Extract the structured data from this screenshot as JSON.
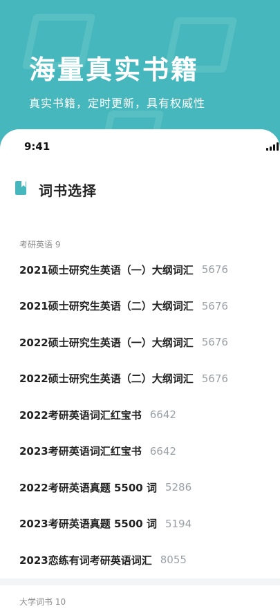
{
  "hero": {
    "title": "海量真实书籍",
    "subtitle": "真实书籍，定时更新，具有权威性"
  },
  "status_bar": {
    "time": "9:41",
    "icons": [
      "signal-icon",
      "wifi-icon",
      "battery-icon"
    ]
  },
  "section": {
    "icon": "book-icon",
    "title": "词书选择"
  },
  "groups": [
    {
      "label": "考研英语 9",
      "items": [
        {
          "title": "2021硕士研究生英语（一）大纲词汇",
          "count": "5676"
        },
        {
          "title": "2021硕士研究生英语（二）大纲词汇",
          "count": "5676"
        },
        {
          "title": "2022硕士研究生英语（一）大纲词汇",
          "count": "5676"
        },
        {
          "title": "2022硕士研究生英语（二）大纲词汇",
          "count": "5676"
        },
        {
          "title": "2022考研英语词汇红宝书",
          "count": "6642"
        },
        {
          "title": "2023考研英语词汇红宝书",
          "count": "6642"
        },
        {
          "title": "2022考研英语真题 5500 词",
          "count": "5286"
        },
        {
          "title": "2023考研英语真题 5500 词",
          "count": "5194"
        },
        {
          "title": "2023恋练有词考研英语词汇",
          "count": "8055"
        }
      ]
    },
    {
      "label": "大学词书 10",
      "items": []
    }
  ],
  "colors": {
    "accent": "#46b8bd",
    "text_primary": "#222222",
    "text_secondary": "#9aa0a6",
    "divider": "#f2f4f6"
  }
}
